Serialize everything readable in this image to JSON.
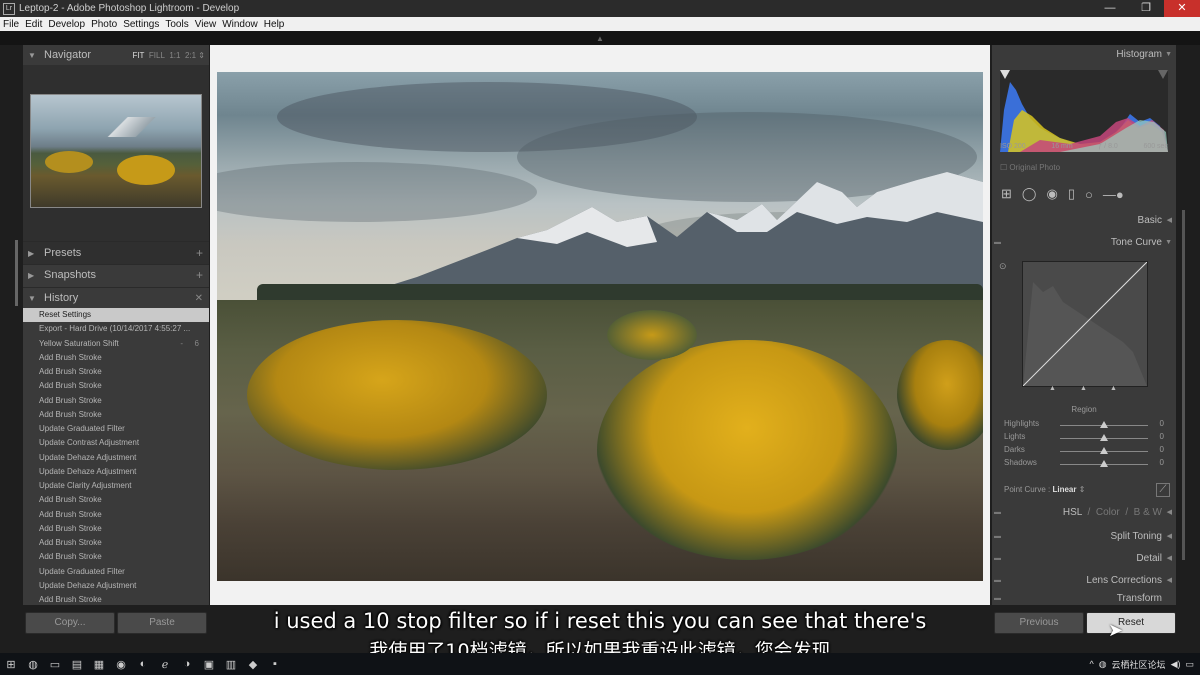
{
  "window": {
    "title": "Leptop-2 - Adobe Photoshop Lightroom - Develop",
    "minimize": "—",
    "maximize": "❐",
    "close": "✕"
  },
  "menu": [
    "File",
    "Edit",
    "Develop",
    "Photo",
    "Settings",
    "Tools",
    "View",
    "Window",
    "Help"
  ],
  "left": {
    "navigator": {
      "label": "Navigator",
      "zoom": [
        "FIT",
        "FILL",
        "1:1",
        "2:1"
      ]
    },
    "presets": "Presets",
    "snapshots": "Snapshots",
    "history": "History",
    "history_items": [
      "Reset Settings",
      "Export - Hard Drive (10/14/2017 4:55:27 ...",
      "Yellow Saturation Shift",
      "Add Brush Stroke",
      "Add Brush Stroke",
      "Add Brush Stroke",
      "Add Brush Stroke",
      "Add Brush Stroke",
      "Update Graduated Filter",
      "Update Contrast Adjustment",
      "Update Dehaze Adjustment",
      "Update Dehaze Adjustment",
      "Update Clarity Adjustment",
      "Add Brush Stroke",
      "Add Brush Stroke",
      "Add Brush Stroke",
      "Add Brush Stroke",
      "Add Brush Stroke",
      "Update Graduated Filter",
      "Update Dehaze Adjustment",
      "Add Brush Stroke"
    ],
    "yellow_sat_vals": [
      "-",
      "6"
    ],
    "copy": "Copy...",
    "paste": "Paste"
  },
  "right": {
    "histogram": "Histogram",
    "meta": [
      "ISO 200",
      "16 mm",
      "ƒ / 8.0",
      "600 sec"
    ],
    "original_photo": "Original Photo",
    "basic": "Basic",
    "tone_curve": "Tone Curve",
    "region": "Region",
    "sliders": [
      {
        "label": "Highlights",
        "value": "0",
        "pos": 0.5
      },
      {
        "label": "Lights",
        "value": "0",
        "pos": 0.5
      },
      {
        "label": "Darks",
        "value": "0",
        "pos": 0.5
      },
      {
        "label": "Shadows",
        "value": "0",
        "pos": 0.5
      }
    ],
    "point_curve_label": "Point Curve :",
    "point_curve_value": "Linear",
    "hsl": "HSL",
    "color": "Color",
    "bw": "B & W",
    "sep": "/",
    "split_toning": "Split Toning",
    "detail": "Detail",
    "lens_corrections": "Lens Corrections",
    "transform": "Transform",
    "previous": "Previous",
    "reset": "Reset"
  },
  "subtitles": {
    "en": "i used a 10 stop filter so if i reset this you can see that there's",
    "zh": "我使用了10档滤镜，所以如果我重设此滤镜，您会发现"
  },
  "taskbar": {
    "tray_text": "云栖社区论坛"
  },
  "colors": {
    "panel": "#3a3a3a",
    "selected_history": "#c9c9c9",
    "close_red": "#c8302b"
  }
}
